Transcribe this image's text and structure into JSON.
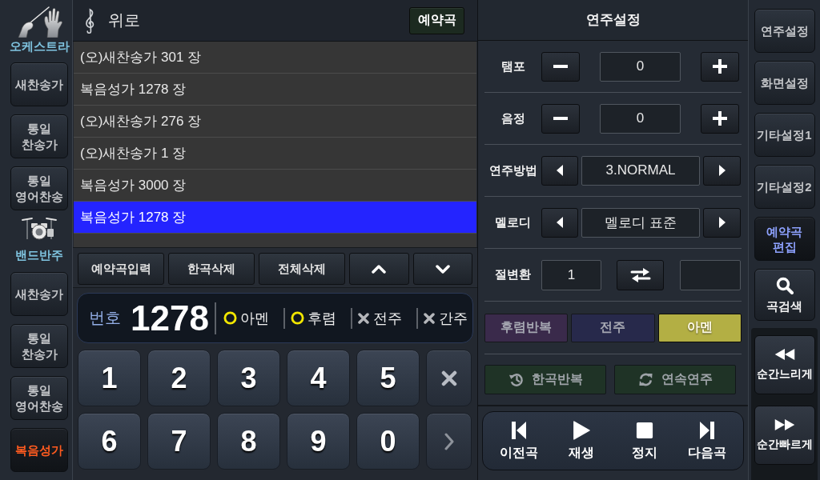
{
  "left_sidebar": {
    "sections": [
      {
        "kind": "orchestra",
        "label": "오케스트라",
        "items": [
          {
            "label": "새찬송가",
            "selected": false
          },
          {
            "label": "통일\n찬송가",
            "selected": false
          },
          {
            "label": "통일\n영어찬송",
            "selected": false
          }
        ]
      },
      {
        "kind": "band",
        "label": "밴드반주",
        "items": [
          {
            "label": "새찬송가",
            "selected": false
          },
          {
            "label": "통일\n찬송가",
            "selected": false
          },
          {
            "label": "통일\n영어찬송",
            "selected": false
          },
          {
            "label": "복음성가",
            "selected": true
          }
        ]
      }
    ]
  },
  "song_panel": {
    "title": "위로",
    "reserved_button": "예약곡",
    "songs": [
      {
        "title": "(오)새찬송가 301 장",
        "selected": false
      },
      {
        "title": "복음성가 1278 장",
        "selected": false
      },
      {
        "title": "(오)새찬송가 276 장",
        "selected": false
      },
      {
        "title": "(오)새찬송가 1 장",
        "selected": false
      },
      {
        "title": "복음성가 3000 장",
        "selected": false
      },
      {
        "title": "복음성가 1278 장",
        "selected": true
      }
    ],
    "toolbar": [
      {
        "kind": "text",
        "label": "예약곡입력"
      },
      {
        "kind": "text",
        "label": "한곡삭제"
      },
      {
        "kind": "text",
        "label": "전체삭제"
      },
      {
        "kind": "up"
      },
      {
        "kind": "down"
      }
    ],
    "number_display": {
      "label": "번호",
      "value": "1278",
      "options": [
        {
          "label": "아멘",
          "on": true
        },
        {
          "label": "후렴",
          "on": true
        },
        {
          "label": "전주",
          "on": false
        },
        {
          "label": "간주",
          "on": false
        }
      ]
    },
    "keypad": [
      {
        "kind": "digit",
        "label": "1"
      },
      {
        "kind": "digit",
        "label": "2"
      },
      {
        "kind": "digit",
        "label": "3"
      },
      {
        "kind": "digit",
        "label": "4"
      },
      {
        "kind": "digit",
        "label": "5"
      },
      {
        "kind": "clear"
      },
      {
        "kind": "digit",
        "label": "6"
      },
      {
        "kind": "digit",
        "label": "7"
      },
      {
        "kind": "digit",
        "label": "8"
      },
      {
        "kind": "digit",
        "label": "9"
      },
      {
        "kind": "digit",
        "label": "0"
      },
      {
        "kind": "next"
      }
    ]
  },
  "settings_panel": {
    "title": "연주설정",
    "rows": [
      {
        "kind": "stepper",
        "label": "탬포",
        "value": "0"
      },
      {
        "kind": "stepper",
        "label": "음정",
        "value": "0"
      },
      {
        "kind": "selector",
        "label": "연주방법",
        "value": "3.NORMAL"
      },
      {
        "kind": "selector",
        "label": "멜로디",
        "value": "멜로디 표준"
      },
      {
        "kind": "verse",
        "label": "절변환",
        "value": "1"
      }
    ],
    "toggles": [
      {
        "label": "후렴반복",
        "color": "#3a2a4b",
        "on": false
      },
      {
        "label": "전주",
        "color": "#27294b",
        "on": false
      },
      {
        "label": "아멘",
        "color": "#b3af44",
        "on": true
      }
    ],
    "repeat_buttons": [
      {
        "kind": "repeat-one",
        "label": "한곡반복",
        "on": false
      },
      {
        "kind": "continuous",
        "label": "연속연주",
        "on": false
      }
    ],
    "transport": [
      {
        "kind": "prev",
        "label": "이전곡"
      },
      {
        "kind": "play",
        "label": "재생"
      },
      {
        "kind": "stop",
        "label": "정지"
      },
      {
        "kind": "next",
        "label": "다음곡"
      }
    ]
  },
  "right_sidebar": {
    "items": [
      {
        "kind": "text",
        "label": "연주설정",
        "selected": false
      },
      {
        "kind": "text",
        "label": "화면설정",
        "selected": false
      },
      {
        "kind": "text",
        "label": "기타설정1",
        "selected": false
      },
      {
        "kind": "text",
        "label": "기타설정2",
        "selected": false
      },
      {
        "kind": "text",
        "label": "예약곡\n편집",
        "selected": true
      },
      {
        "kind": "search",
        "label": "곡검색",
        "selected": false
      }
    ],
    "speed_buttons": [
      {
        "kind": "slow",
        "label": "순간느리게"
      },
      {
        "kind": "fast",
        "label": "순간빠르게"
      }
    ]
  }
}
